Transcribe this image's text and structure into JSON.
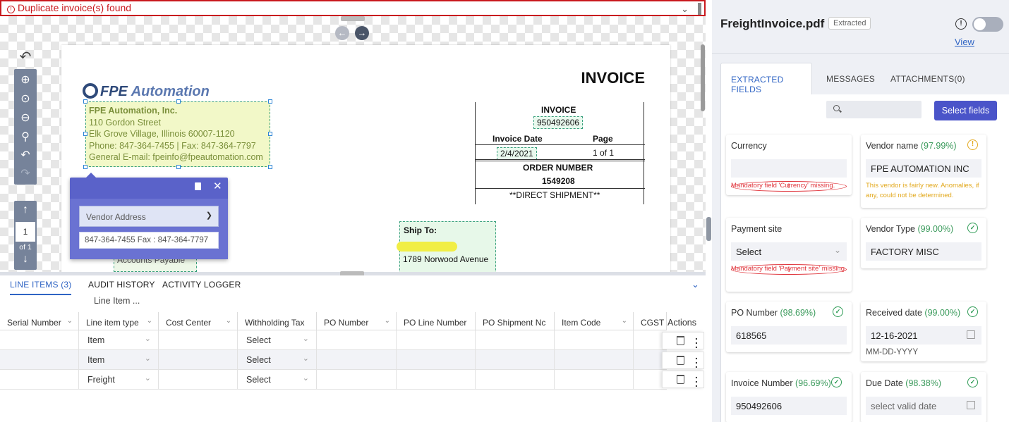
{
  "banner": {
    "text": "Duplicate invoice(s) found",
    "icon": "alert-circle-icon"
  },
  "document": {
    "heading": "INVOICE",
    "logo": {
      "brand": "FPE",
      "word": "Automation"
    },
    "vendor_block": [
      "FPE Automation, Inc.",
      "110 Gordon Street",
      "Elk Grove Village, Illinois 60007-1120",
      "Phone: 847-364-7455 | Fax: 847-364-7797",
      "General E-mail: fpeinfo@fpeautomation.com"
    ],
    "invoice_label": "INVOICE",
    "invoice_number": "950492606",
    "invoice_date_label": "Invoice Date",
    "invoice_date": "2/4/2021",
    "page_label": "Page",
    "page_value": "1 of 1",
    "order_number_label": "ORDER NUMBER",
    "order_number": "1549208",
    "shipment_note": "**DIRECT SHIPMENT**",
    "ship_to_label": "Ship To:",
    "ship_to_address": "1789 Norwood Avenue",
    "ap_text": "Accounts Payable"
  },
  "popup": {
    "field_select": "Vendor Address",
    "field_value": "847-364-7455 Fax : 847-364-7797"
  },
  "pager": {
    "current": "1",
    "of": "of 1"
  },
  "bottom": {
    "tabs": [
      "LINE ITEMS (3)",
      "AUDIT HISTORY",
      "ACTIVITY LOGGER"
    ],
    "group_header": "Line Item ...",
    "columns": [
      "Serial Number",
      "Line item type",
      "Cost Center",
      "Withholding Tax",
      "PO Number",
      "PO Line Number",
      "PO Shipment Nc",
      "Item Code",
      "CGST"
    ],
    "actions_label": "Actions",
    "rows": [
      {
        "type": "Item",
        "tax": "Select"
      },
      {
        "type": "Item",
        "tax": "Select"
      },
      {
        "type": "Freight",
        "tax": "Select"
      }
    ]
  },
  "right": {
    "file_title": "FreightInvoice.pdf",
    "badge": "Extracted",
    "view_link": "View",
    "tabs": [
      "EXTRACTED FIELDS",
      "MESSAGES",
      "ATTACHMENTS(0)"
    ],
    "select_fields": "Select fields",
    "search_placeholder": "",
    "fields": {
      "currency": {
        "label": "Currency",
        "value": "",
        "message": "Mandatory field 'Currency' missing."
      },
      "vendor_name": {
        "label": "Vendor name",
        "conf": "(97.99%)",
        "value": "FPE AUTOMATION INC",
        "message": "This vendor is fairly new. Anomalies, if any, could not be determined."
      },
      "payment_site": {
        "label": "Payment site",
        "value": "Select",
        "message": "Mandatory field 'Payment site' missing."
      },
      "vendor_type": {
        "label": "Vendor Type",
        "conf": "(99.00%)",
        "value": "FACTORY MISC"
      },
      "po_number": {
        "label": "PO Number",
        "conf": "(98.69%)",
        "value": "618565"
      },
      "received_date": {
        "label": "Received date",
        "conf": "(99.00%)",
        "value": "12-16-2021",
        "hint": "MM-DD-YYYY"
      },
      "invoice_number": {
        "label": "Invoice Number",
        "conf": "(96.69%)",
        "value": "950492606"
      },
      "due_date": {
        "label": "Due Date",
        "conf": "(98.38%)",
        "value": "select valid date"
      }
    }
  },
  "colors": {
    "accent": "#4a54c9",
    "link": "#2f64c4",
    "error": "#e0353c",
    "warning": "#e2a81c",
    "success": "#2e9b55"
  }
}
